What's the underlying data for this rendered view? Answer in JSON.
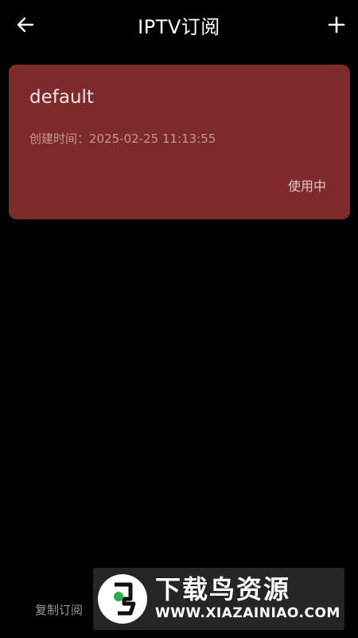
{
  "header": {
    "title": "IPTV订阅",
    "back_icon": "arrow-left-icon",
    "add_icon": "plus-icon"
  },
  "subscriptions": [
    {
      "name": "default",
      "created": "创建时间：2025-02-25 11:13:55",
      "status": "使用中"
    }
  ],
  "footer": {
    "copy_label": "复制订阅"
  },
  "watermark": {
    "title": "下载鸟资源",
    "url": "WWW.XIAZAINIAO.COM"
  },
  "colors": {
    "background": "#000000",
    "card": "#7e2a2b",
    "text_primary": "#ffffff",
    "text_muted": "#c39595"
  }
}
